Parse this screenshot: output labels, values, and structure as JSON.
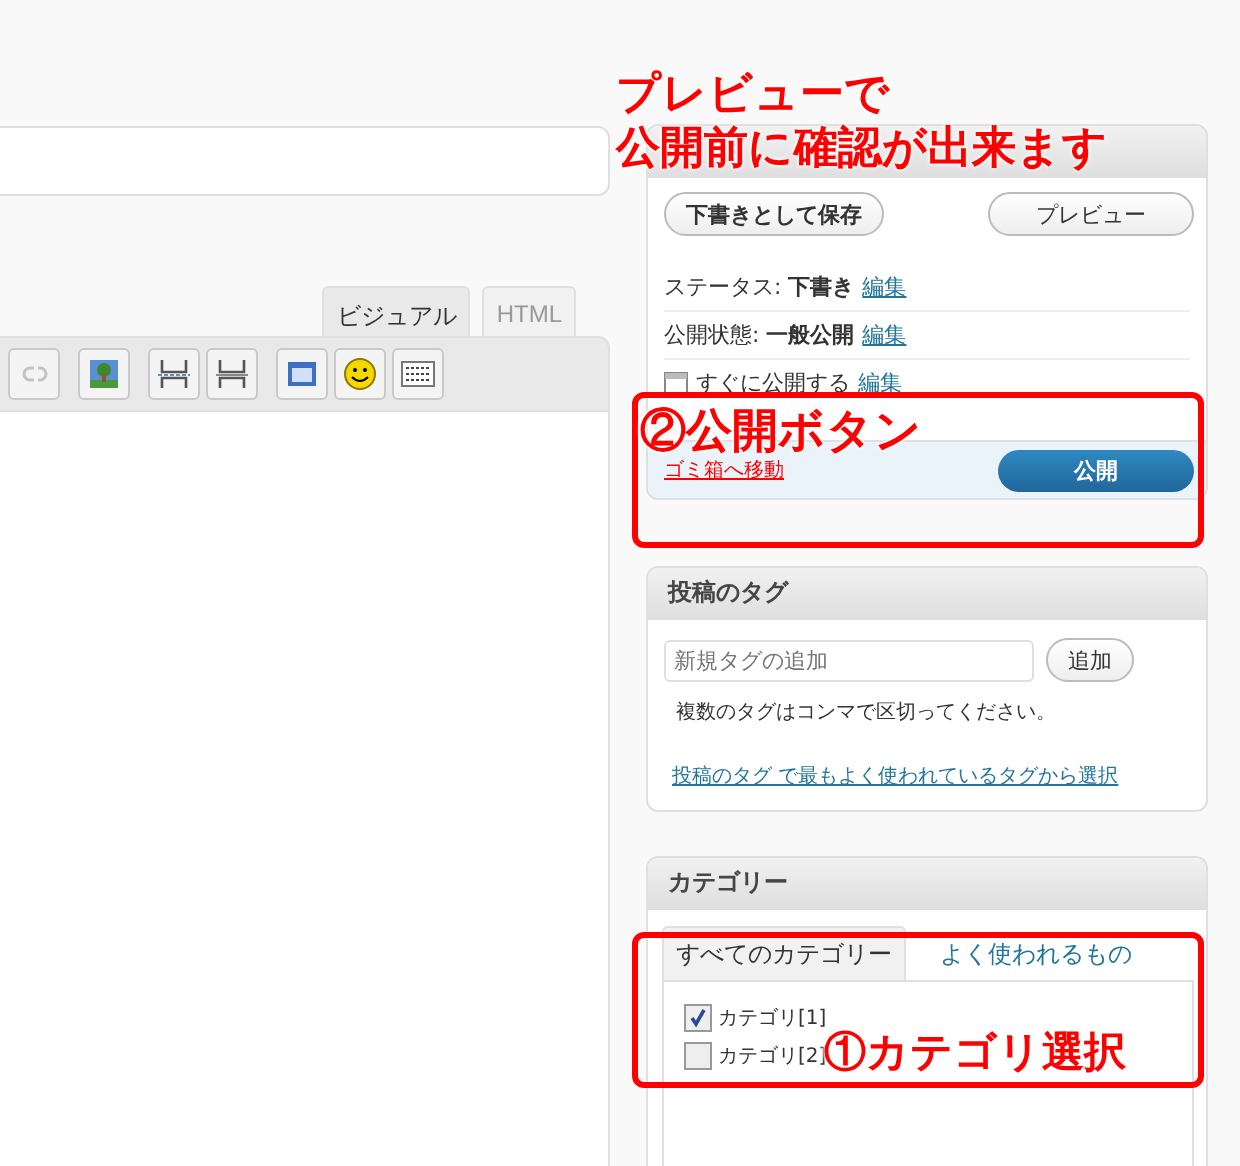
{
  "editor": {
    "tabs": [
      {
        "label": "ビジュアル",
        "selected": true
      },
      {
        "label": "HTML",
        "selected": false
      }
    ],
    "toolbar": [
      {
        "kind": "unlink",
        "disabled": true
      },
      {
        "kind": "image",
        "disabled": false
      },
      {
        "kind": "more",
        "disabled": false
      },
      {
        "kind": "pagebreak",
        "disabled": false
      },
      {
        "kind": "window",
        "disabled": false
      },
      {
        "kind": "smiley",
        "disabled": false
      },
      {
        "kind": "charmap",
        "disabled": false
      }
    ]
  },
  "publish": {
    "buttons": [
      "下書きとして保存",
      "プレビュー"
    ],
    "rows": [
      {
        "kind": "status",
        "label": "ステータス: ",
        "value": "下書き",
        "link": "編集"
      },
      {
        "kind": "visibility",
        "label": "公開状態: ",
        "value": "一般公開",
        "link": "編集"
      },
      {
        "kind": "schedule",
        "label": "すぐに",
        "value": "公開する",
        "link": "編集"
      }
    ],
    "trash_link": "ゴミ箱へ移動",
    "publish_button": "公開"
  },
  "tags": {
    "title": "投稿のタグ",
    "placeholder": "新規タグの追加",
    "add_button": "追加",
    "help": "複数のタグはコンマで区切ってください。",
    "choose_link": "投稿のタグ で最もよく使われているタグから選択"
  },
  "categories": {
    "title": "カテゴリー",
    "tabs": [
      {
        "label": "すべてのカテゴリー",
        "selected": true
      },
      {
        "label": "よく使われるもの",
        "selected": false
      }
    ],
    "items": [
      {
        "label": "カテゴリ[1]",
        "checked": true
      },
      {
        "label": "カテゴリ[2]",
        "checked": false
      }
    ]
  },
  "annotations": [
    {
      "kind": "note",
      "lines": [
        "プレビューで",
        "公開前に確認が出来ます"
      ]
    },
    {
      "kind": "callout",
      "text": "②公開ボタン"
    },
    {
      "kind": "callout",
      "text": "①カテゴリ選択"
    }
  ]
}
